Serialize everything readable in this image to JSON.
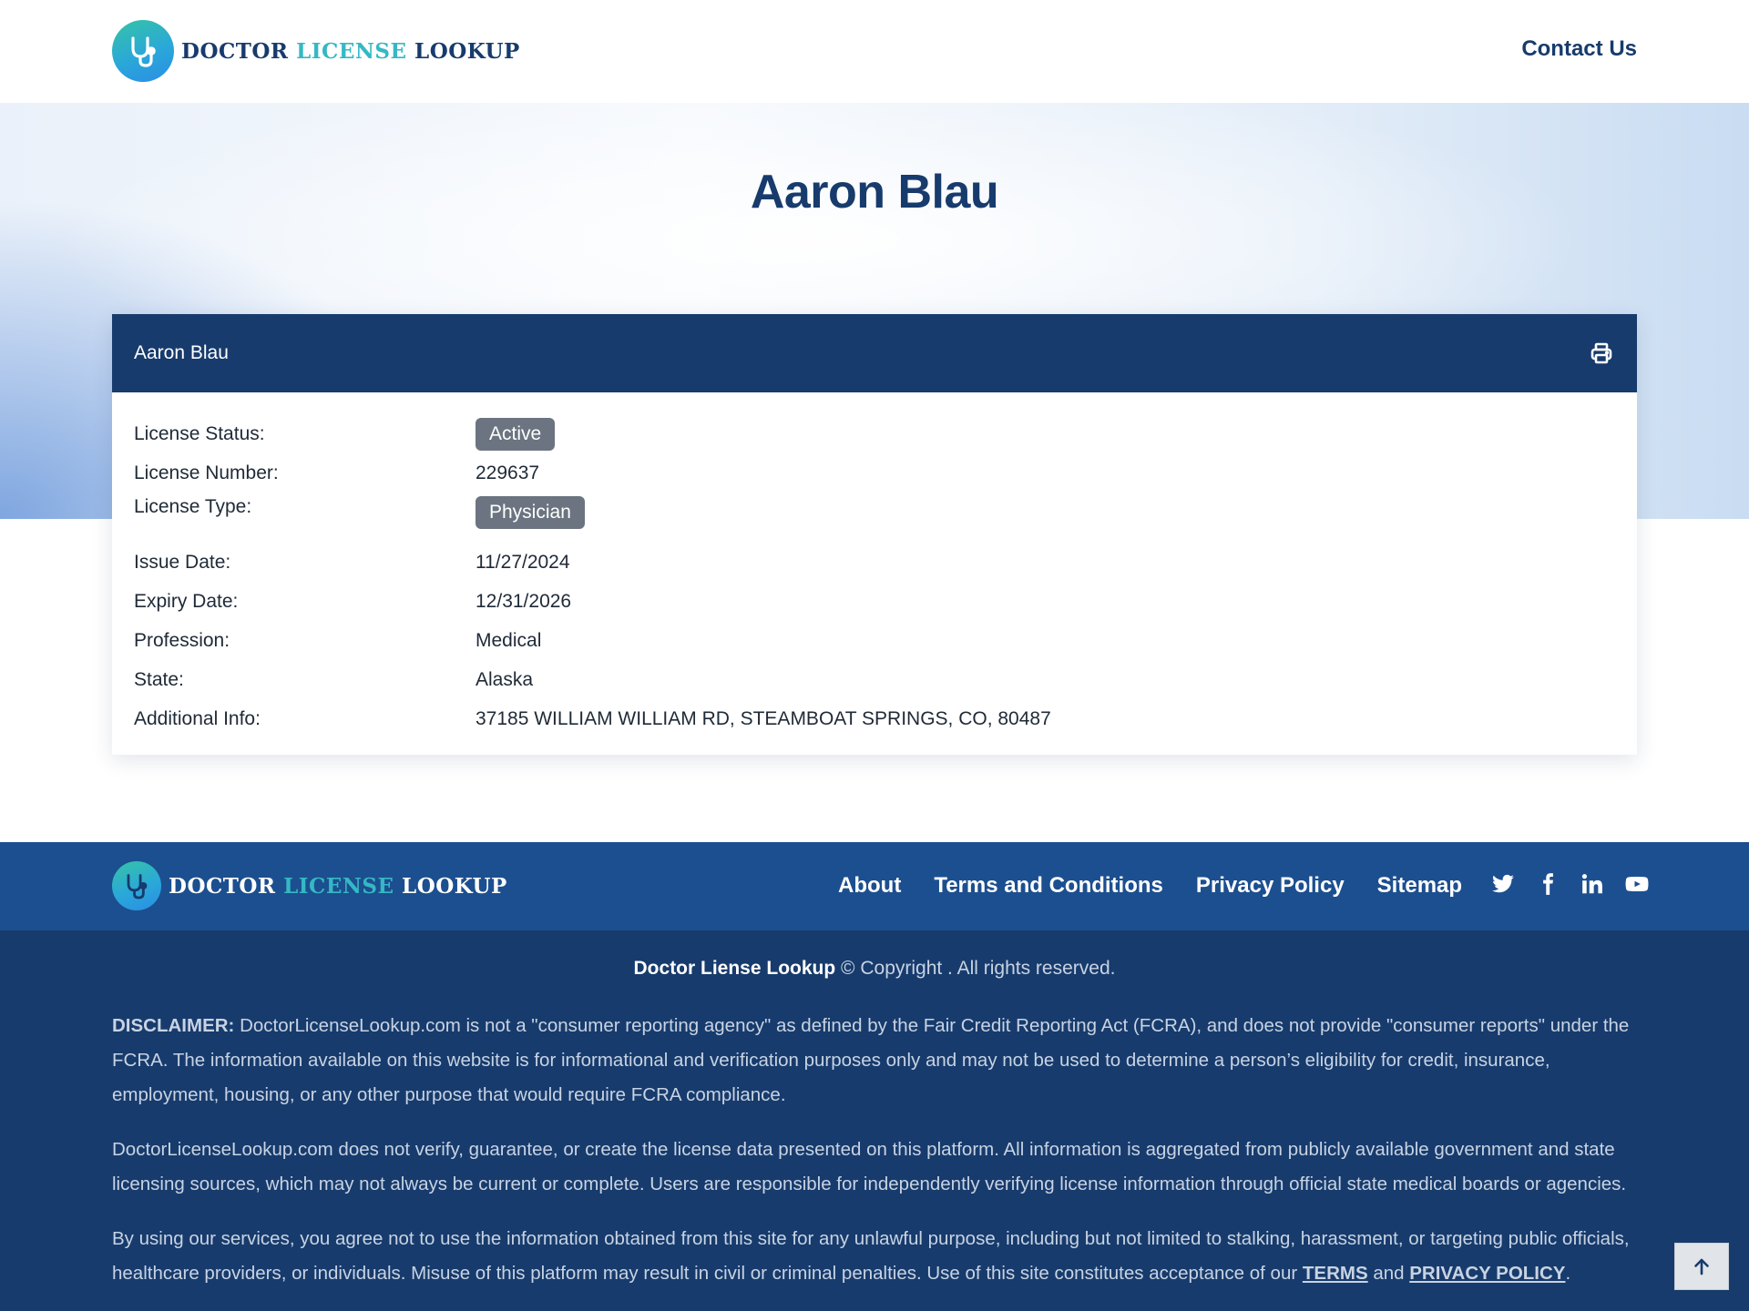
{
  "header": {
    "logo_word1": "DOCTOR",
    "logo_word2": "LICENSE",
    "logo_word3": "LOOKUP",
    "contact_label": "Contact Us"
  },
  "hero": {
    "title": "Aaron Blau"
  },
  "card": {
    "name": "Aaron Blau",
    "print_icon": "print-icon",
    "rows": [
      {
        "label": "License Status:",
        "value": "Active",
        "badge": true
      },
      {
        "label": "License Number:",
        "value": "229637"
      },
      {
        "label": "License Type:",
        "value": "Physician",
        "badge": true
      },
      {
        "label": "Issue Date:",
        "value": "11/27/2024"
      },
      {
        "label": "Expiry Date:",
        "value": "12/31/2026"
      },
      {
        "label": "Profession:",
        "value": "Medical"
      },
      {
        "label": "State:",
        "value": "Alaska"
      },
      {
        "label": "Additional Info:",
        "value": "37185 WILLIAM WILLIAM RD, STEAMBOAT SPRINGS, CO, 80487"
      }
    ]
  },
  "footer": {
    "logo_word1": "DOCTOR",
    "logo_word2": "LICENSE",
    "logo_word3": "LOOKUP",
    "nav": [
      "About",
      "Terms and Conditions",
      "Privacy Policy",
      "Sitemap"
    ],
    "social_icons": [
      "twitter-icon",
      "facebook-icon",
      "linkedin-icon",
      "youtube-icon"
    ],
    "copyright_brand": "Doctor Liense Lookup",
    "copyright_rest": " © Copyright . All rights reserved.",
    "disclaimer_label": "DISCLAIMER:",
    "disclaimer_text": " DoctorLicenseLookup.com is not a \"consumer reporting agency\" as defined by the Fair Credit Reporting Act (FCRA), and does not provide \"consumer reports\" under the FCRA. The information available on this website is for informational and verification purposes only and may not be used to determine a person’s eligibility for credit, insurance, employment, housing, or any other purpose that would require FCRA compliance.",
    "para2": "DoctorLicenseLookup.com does not verify, guarantee, or create the license data presented on this platform. All information is aggregated from publicly available government and state licensing sources, which may not always be current or complete. Users are responsible for independently verifying license information through official state medical boards or agencies.",
    "para3_text": "By using our services, you agree not to use the information obtained from this site for any unlawful purpose, including but not limited to stalking, harassment, or targeting public officials, healthcare providers, or individuals. Misuse of this platform may result in civil or criminal penalties. Use of this site constitutes acceptance of our ",
    "terms_link": "TERMS",
    "and_text": " and ",
    "privacy_link": "PRIVACY POLICY",
    "period": "."
  },
  "colors": {
    "brand_dark": "#173b6c",
    "footer_top": "#1c4f8f",
    "accent": "#35b8c4",
    "badge": "#6b7480"
  },
  "back_to_top_icon": "arrow-up-icon"
}
